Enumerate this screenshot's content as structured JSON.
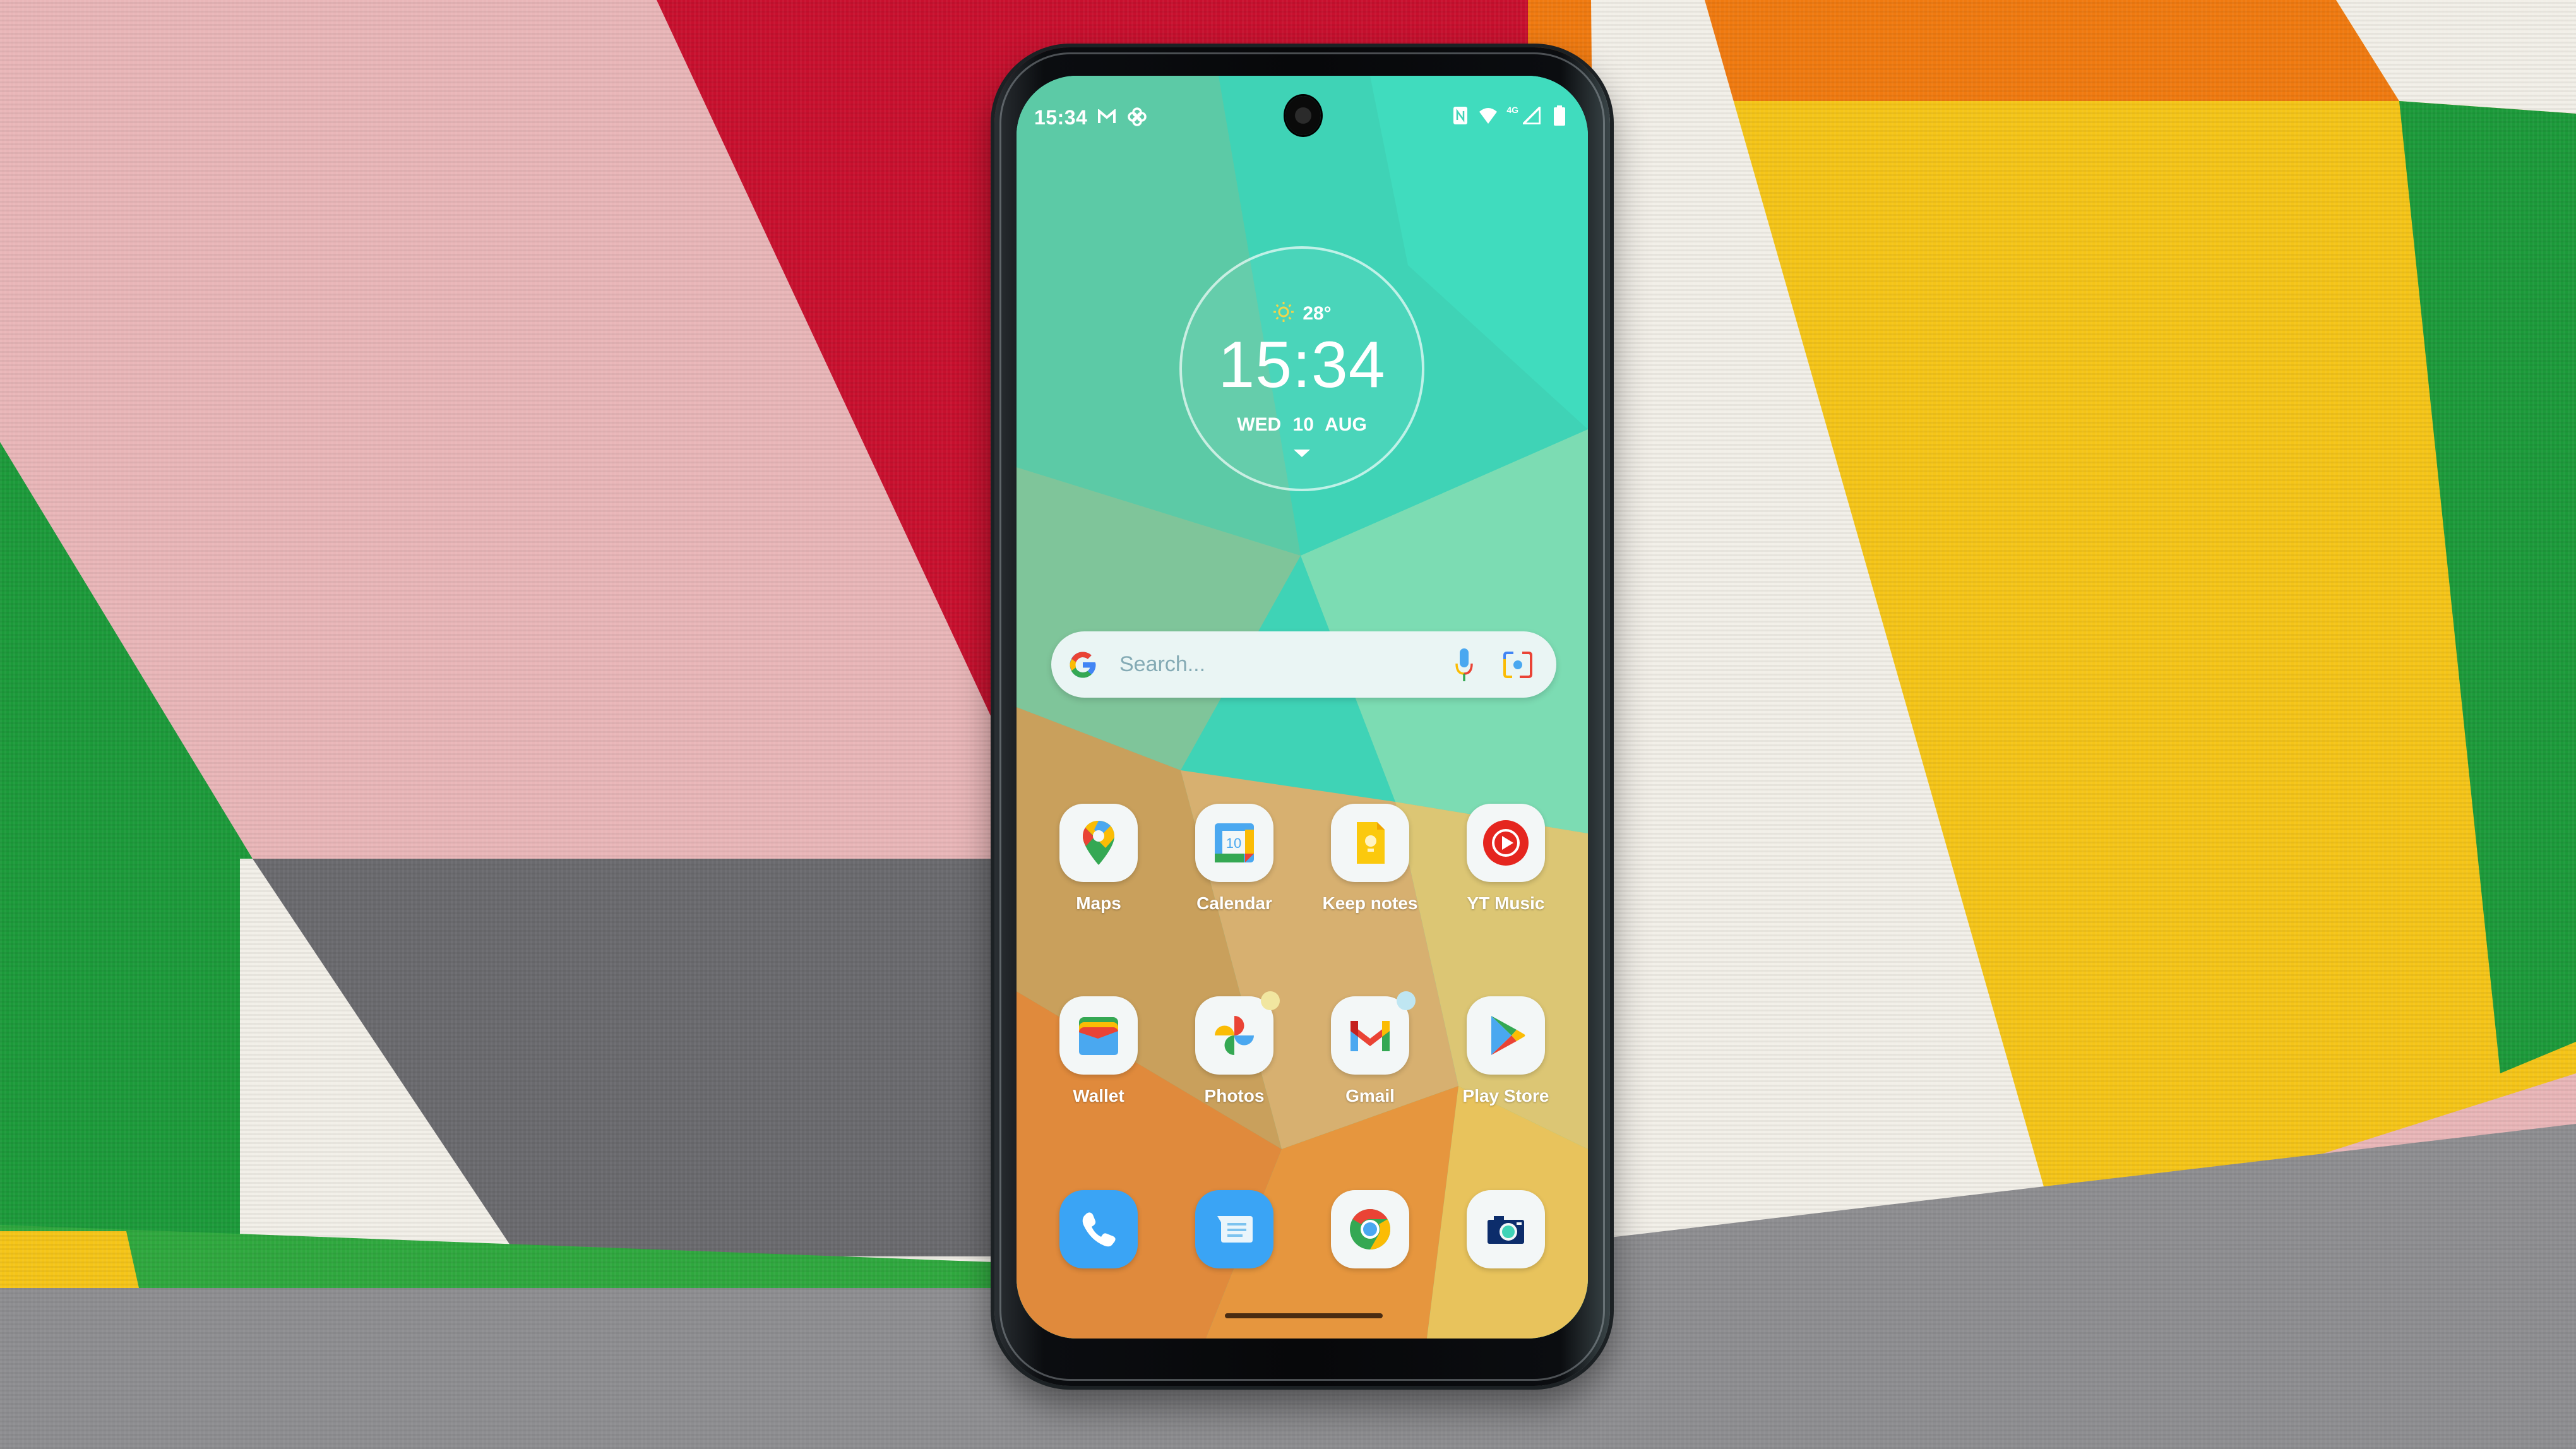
{
  "scene": {
    "backdrop_colors": {
      "pink": "#e8b4b6",
      "red": "#c8102e",
      "orange": "#f07a10",
      "yellow": "#f7c71a",
      "green": "#1c9a3a",
      "grey": "#6a6a6e",
      "white": "#f2efe8",
      "couch": "#8d8d90"
    }
  },
  "status_bar": {
    "time": "15:34",
    "left_icons": [
      "gmail-icon",
      "pinwheel-icon"
    ],
    "network_label": "4G",
    "right_icons": [
      "nfc-icon",
      "wifi-icon",
      "signal-icon",
      "battery-icon"
    ]
  },
  "clock_widget": {
    "weather_icon": "sun-icon",
    "temperature": "28°",
    "time": "15:34",
    "date": "WED 10 AUG",
    "expand_icon": "caret-down-icon"
  },
  "search_bar": {
    "placeholder": "Search...",
    "value": "",
    "left_icon": "google-g-icon",
    "mic_icon": "microphone-icon",
    "lens_icon": "lens-camera-icon"
  },
  "home_apps": [
    [
      {
        "label": "Maps",
        "icon": "maps-icon"
      },
      {
        "label": "Calendar",
        "icon": "calendar-icon",
        "icon_text": "10"
      },
      {
        "label": "Keep notes",
        "icon": "keep-icon"
      },
      {
        "label": "YT Music",
        "icon": "yt-music-icon"
      }
    ],
    [
      {
        "label": "Wallet",
        "icon": "wallet-icon"
      },
      {
        "label": "Photos",
        "icon": "photos-icon",
        "notification_dot": "#f1e6a0"
      },
      {
        "label": "Gmail",
        "icon": "gmail-icon",
        "notification_dot": "#bfe6f2"
      },
      {
        "label": "Play Store",
        "icon": "play-store-icon"
      }
    ]
  ],
  "dock": [
    {
      "label": "Phone",
      "icon": "phone-icon"
    },
    {
      "label": "Messages",
      "icon": "messages-icon"
    },
    {
      "label": "Chrome",
      "icon": "chrome-icon"
    },
    {
      "label": "Camera",
      "icon": "camera-icon"
    }
  ],
  "colors": {
    "google_blue": "#4285f4",
    "google_red": "#ea4335",
    "google_yellow": "#fbbc05",
    "google_green": "#34a853",
    "dock_blue": "#3aa4f5",
    "wallpaper_teal": "#3fd3b6",
    "wallpaper_orange": "#e08a3c"
  }
}
